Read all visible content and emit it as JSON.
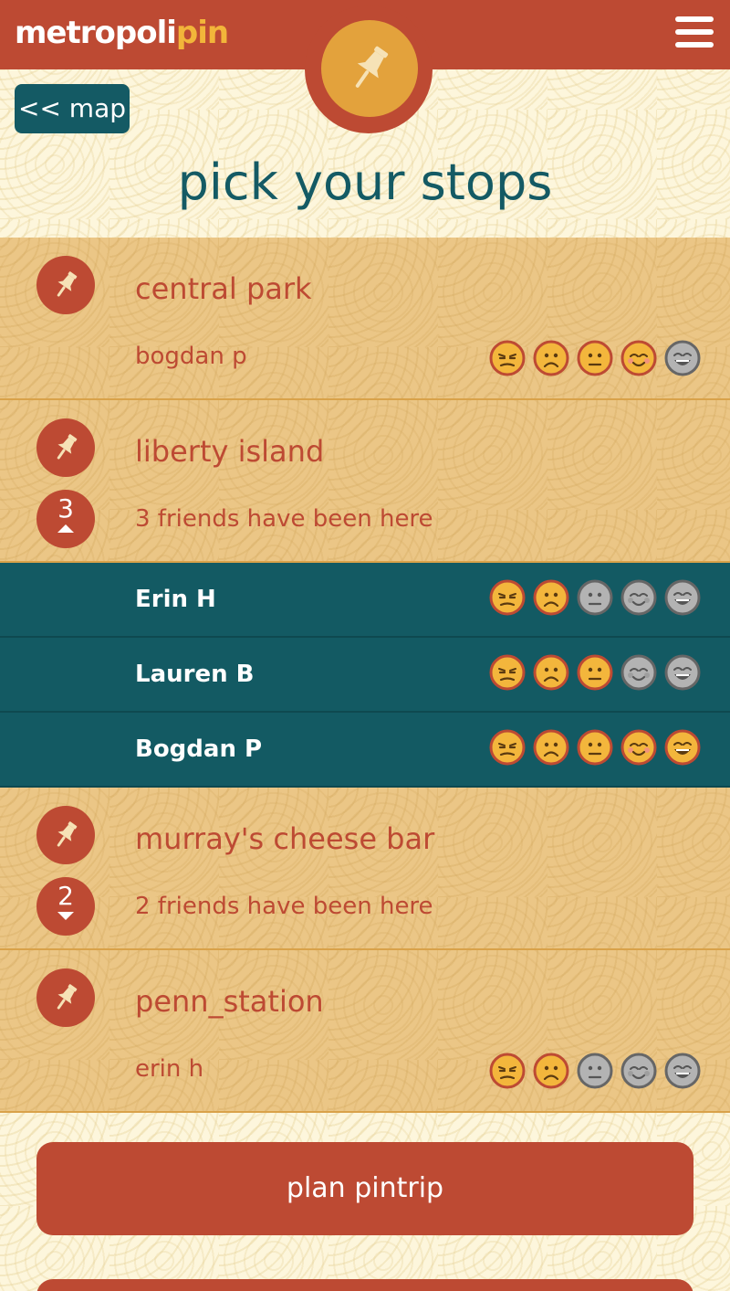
{
  "header": {
    "logo_part1": "metropoli",
    "logo_part2": "pin",
    "menu_icon": "hamburger-icon",
    "badge_icon": "pushpin-icon",
    "colors": {
      "primary": "#bd4a33",
      "accent": "#f2b53a",
      "teal": "#145a64"
    }
  },
  "back_button": {
    "label": "<< map"
  },
  "page": {
    "title": "pick your stops"
  },
  "stops": [
    {
      "name": "central park",
      "subtitle": "bogdan p",
      "ratings": [
        "active",
        "active",
        "active",
        "active",
        "inactive"
      ]
    },
    {
      "name": "liberty island",
      "subtitle": "3 friends have been here",
      "count": "3",
      "expanded": true,
      "friends": [
        {
          "name": "Erin H",
          "ratings": [
            "active",
            "active",
            "inactive",
            "inactive",
            "inactive"
          ]
        },
        {
          "name": "Lauren B",
          "ratings": [
            "active",
            "active",
            "active",
            "inactive",
            "inactive"
          ]
        },
        {
          "name": "Bogdan P",
          "ratings": [
            "active",
            "active",
            "active",
            "active",
            "active"
          ]
        }
      ]
    },
    {
      "name": "murray's cheese bar",
      "subtitle": "2 friends have been here",
      "count": "2",
      "expanded": false
    },
    {
      "name": "penn_station",
      "subtitle": "erin h",
      "ratings": [
        "active",
        "active",
        "inactive",
        "inactive",
        "inactive"
      ]
    }
  ],
  "rating_faces": [
    "unamused-icon",
    "frown-icon",
    "neutral-icon",
    "blush-icon",
    "grin-icon"
  ],
  "actions": {
    "plan_label": "plan pintrip"
  }
}
